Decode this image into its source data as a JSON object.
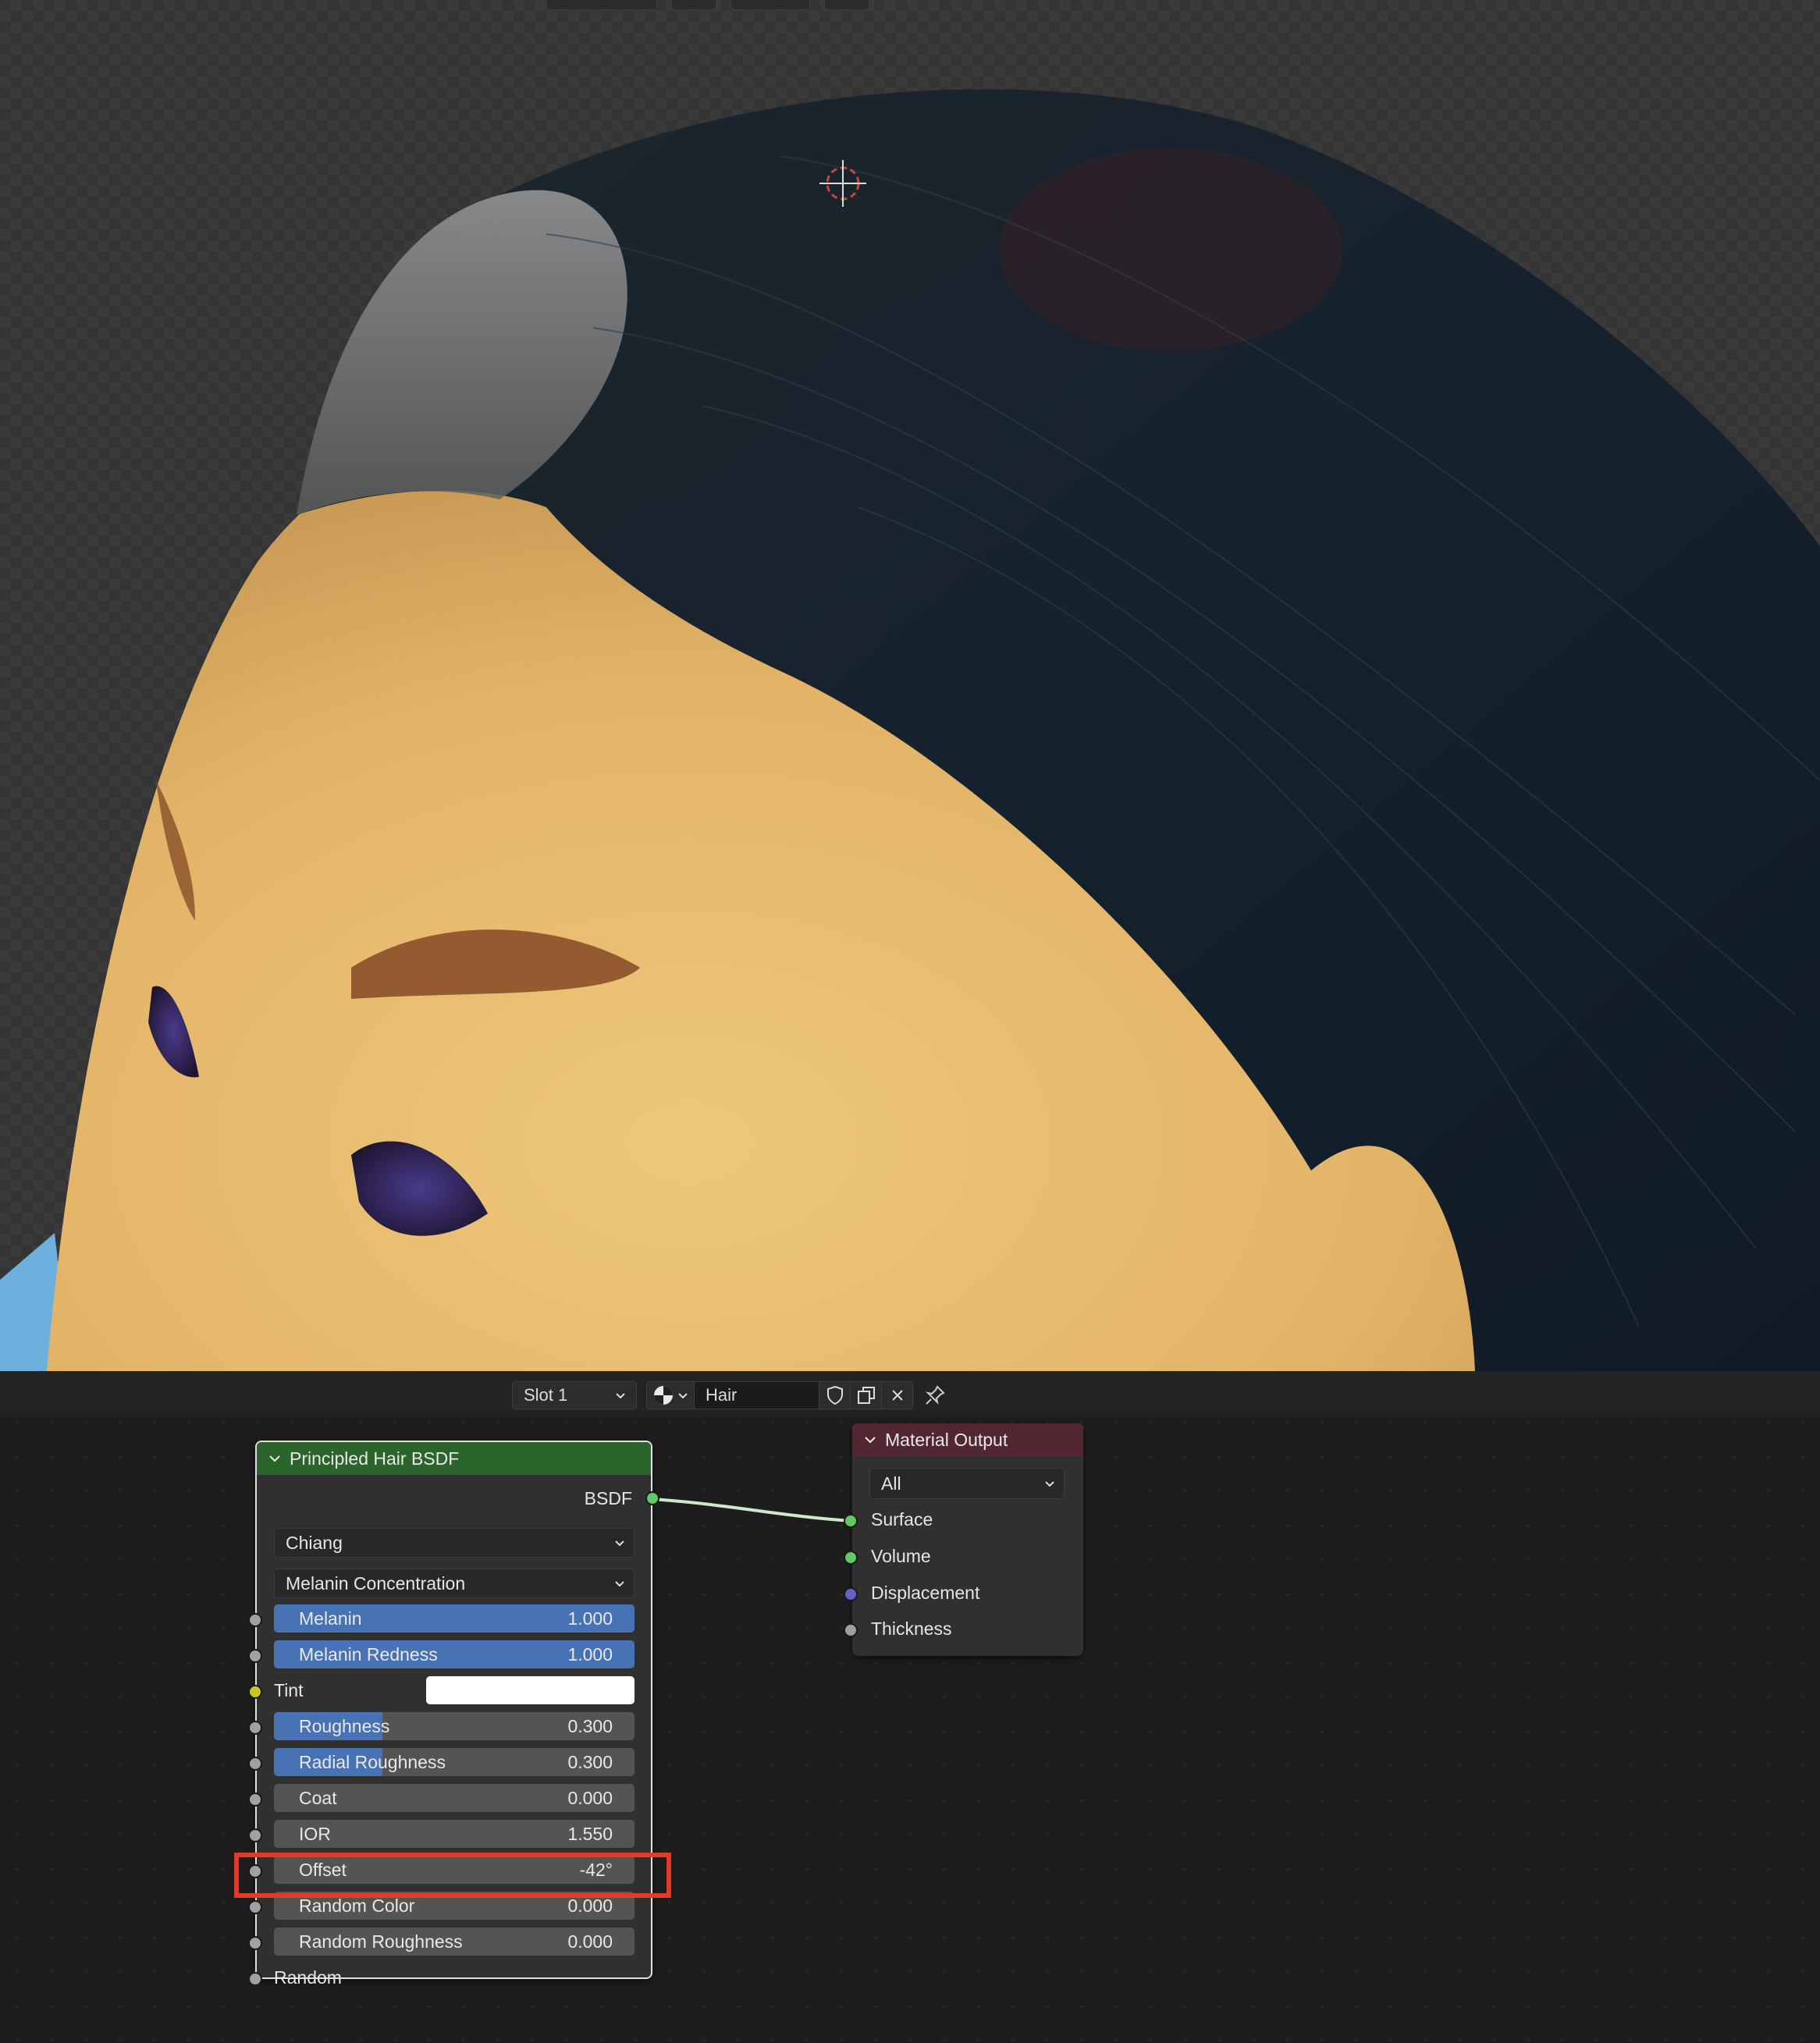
{
  "node_editor": {
    "slot_select": "Slot 1",
    "material_name": "Hair"
  },
  "hair_node": {
    "title": "Principled Hair BSDF",
    "output_label": "BSDF",
    "model": "Chiang",
    "parametrization": "Melanin Concentration",
    "tint_label": "Tint",
    "tint_color": "#ffffff",
    "random_label": "Random",
    "fields": [
      {
        "label": "Melanin",
        "value": "1.000",
        "fraction": 1.0
      },
      {
        "label": "Melanin Redness",
        "value": "1.000",
        "fraction": 1.0
      },
      {
        "label": "Roughness",
        "value": "0.300",
        "fraction": 0.3
      },
      {
        "label": "Radial Roughness",
        "value": "0.300",
        "fraction": 0.3
      },
      {
        "label": "Coat",
        "value": "0.000",
        "fraction": 0.0
      },
      {
        "label": "IOR",
        "value": "1.550",
        "fraction": 0.0
      },
      {
        "label": "Offset",
        "value": "-42°",
        "fraction": 0.0
      },
      {
        "label": "Random Color",
        "value": "0.000",
        "fraction": 0.0
      },
      {
        "label": "Random Roughness",
        "value": "0.000",
        "fraction": 0.0
      }
    ]
  },
  "output_node": {
    "title": "Material Output",
    "target": "All",
    "inputs": [
      "Surface",
      "Volume",
      "Displacement",
      "Thickness"
    ]
  },
  "colors": {
    "socket_shader": "#63c763",
    "socket_vector": "#6363c7",
    "socket_float": "#a1a1a1",
    "socket_color": "#c7c729",
    "slider_fill": "#4772b3",
    "highlight_box": "#e53a23",
    "hair_node_header": "#2b652b",
    "output_node_header": "#522732"
  }
}
